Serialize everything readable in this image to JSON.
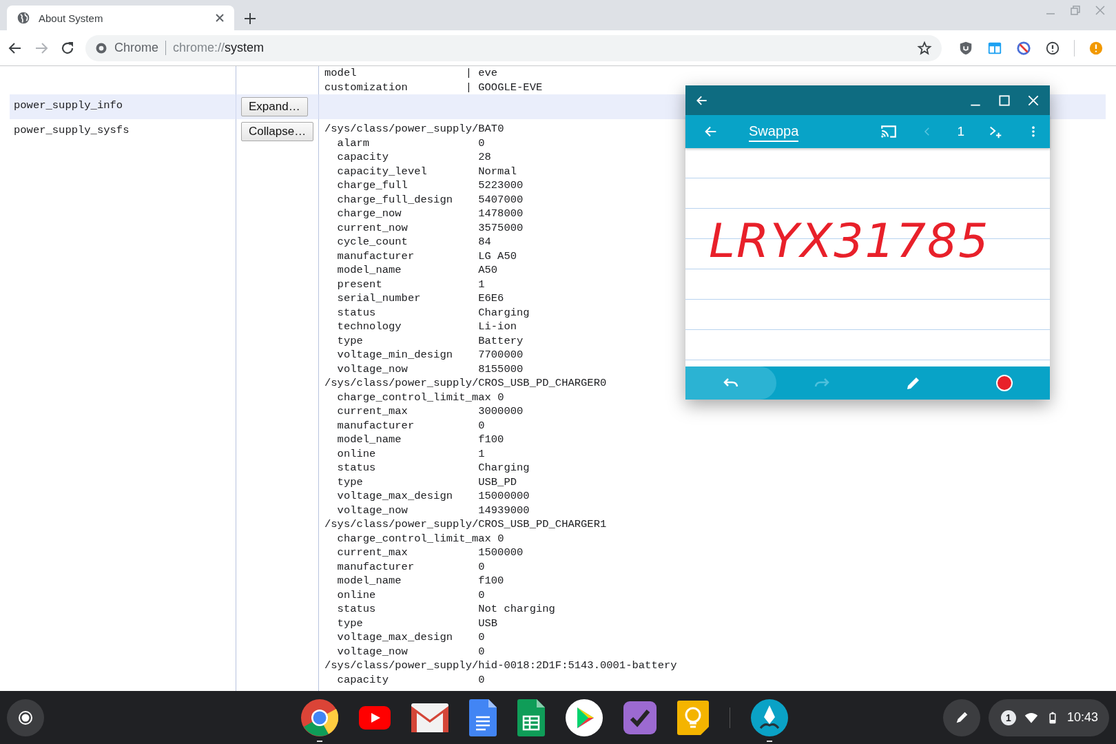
{
  "browser": {
    "tab": {
      "title": "About System",
      "selected": true
    },
    "omnibox": {
      "chip": "Chrome",
      "scheme": "chrome://",
      "path": "system"
    }
  },
  "page": {
    "header_lines": [
      {
        "key": "model",
        "separator": "|",
        "value": "eve"
      },
      {
        "key": "customization",
        "separator": "|",
        "value": "GOOGLE-EVE"
      }
    ],
    "rows": [
      {
        "name": "power_supply_info",
        "button": "Expand…",
        "highlighted": true,
        "sections": []
      },
      {
        "name": "power_supply_sysfs",
        "button": "Collapse…",
        "highlighted": false,
        "sections": [
          {
            "path": "/sys/class/power_supply/BAT0",
            "entries": [
              {
                "key": "alarm",
                "value": "0"
              },
              {
                "key": "capacity",
                "value": "28"
              },
              {
                "key": "capacity_level",
                "value": "Normal"
              },
              {
                "key": "charge_full",
                "value": "5223000"
              },
              {
                "key": "charge_full_design",
                "value": "5407000"
              },
              {
                "key": "charge_now",
                "value": "1478000"
              },
              {
                "key": "current_now",
                "value": "3575000"
              },
              {
                "key": "cycle_count",
                "value": "84"
              },
              {
                "key": "manufacturer",
                "value": "LG A50"
              },
              {
                "key": "model_name",
                "value": "A50"
              },
              {
                "key": "present",
                "value": "1"
              },
              {
                "key": "serial_number",
                "value": "E6E6"
              },
              {
                "key": "status",
                "value": "Charging"
              },
              {
                "key": "technology",
                "value": "Li-ion"
              },
              {
                "key": "type",
                "value": "Battery"
              },
              {
                "key": "voltage_min_design",
                "value": "7700000"
              },
              {
                "key": "voltage_now",
                "value": "8155000"
              }
            ]
          },
          {
            "path": "/sys/class/power_supply/CROS_USB_PD_CHARGER0",
            "entries": [
              {
                "key": "charge_control_limit_max",
                "value": "0"
              },
              {
                "key": "current_max",
                "value": "3000000"
              },
              {
                "key": "manufacturer",
                "value": "0"
              },
              {
                "key": "model_name",
                "value": "f100"
              },
              {
                "key": "online",
                "value": "1"
              },
              {
                "key": "status",
                "value": "Charging"
              },
              {
                "key": "type",
                "value": "USB_PD"
              },
              {
                "key": "voltage_max_design",
                "value": "15000000"
              },
              {
                "key": "voltage_now",
                "value": "14939000"
              }
            ]
          },
          {
            "path": "/sys/class/power_supply/CROS_USB_PD_CHARGER1",
            "entries": [
              {
                "key": "charge_control_limit_max",
                "value": "0"
              },
              {
                "key": "current_max",
                "value": "1500000"
              },
              {
                "key": "manufacturer",
                "value": "0"
              },
              {
                "key": "model_name",
                "value": "f100"
              },
              {
                "key": "online",
                "value": "0"
              },
              {
                "key": "status",
                "value": "Not charging"
              },
              {
                "key": "type",
                "value": "USB"
              },
              {
                "key": "voltage_max_design",
                "value": "0"
              },
              {
                "key": "voltage_now",
                "value": "0"
              }
            ]
          },
          {
            "path": "/sys/class/power_supply/hid-0018:2D1F:5143.0001-battery",
            "entries": [
              {
                "key": "capacity",
                "value": "0"
              }
            ]
          }
        ]
      }
    ]
  },
  "app_window": {
    "title": "Swappa",
    "page": "1",
    "previous_disabled": true,
    "redo_disabled": true,
    "undo_pressed": true,
    "handwriting": "LRYX31785"
  },
  "shelf": {
    "apps": [
      {
        "kind": "chrome",
        "running": true
      },
      {
        "kind": "youtube",
        "running": false
      },
      {
        "kind": "gmail",
        "running": false
      },
      {
        "kind": "docs",
        "running": false
      },
      {
        "kind": "sheets",
        "running": false
      },
      {
        "kind": "play",
        "running": false
      },
      {
        "kind": "tasks",
        "running": false
      },
      {
        "kind": "keep",
        "running": false
      },
      {
        "kind": "pen",
        "running": true
      }
    ],
    "notification_count": "1",
    "time": "10:43"
  }
}
